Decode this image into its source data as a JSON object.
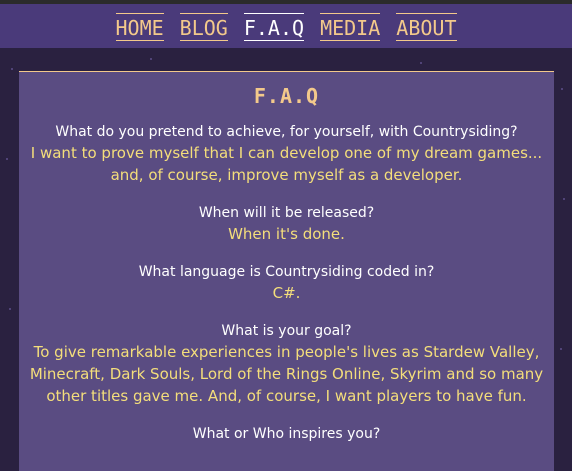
{
  "nav": {
    "items": [
      {
        "label": "HOME",
        "active": false
      },
      {
        "label": "BLOG",
        "active": false
      },
      {
        "label": "F.A.Q",
        "active": true
      },
      {
        "label": "MEDIA",
        "active": false
      },
      {
        "label": "ABOUT",
        "active": false
      }
    ]
  },
  "faq": {
    "title": "F.A.Q",
    "items": [
      {
        "question": "What do you pretend to achieve, for yourself, with Countrysiding?",
        "answer": "I want to prove myself that I can develop one of my dream games... and, of course, improve myself as a developer."
      },
      {
        "question": "When will it be released?",
        "answer": "When it's done."
      },
      {
        "question": "What language is Countrysiding coded in?",
        "answer": "C#."
      },
      {
        "question": "What is your goal?",
        "answer": "To give remarkable experiences in people's lives as Stardew Valley, Minecraft, Dark Souls, Lord of the Rings Online, Skyrim and so many other titles gave me. And, of course, I want players to have fun."
      },
      {
        "question": "What or Who inspires you?",
        "answer": ""
      }
    ]
  },
  "colors": {
    "background": "#2a2140",
    "topbar": "#4a3a7a",
    "panel": "#5a4c82",
    "accent": "#f3c98b",
    "answer": "#f4de7b",
    "question": "#ffffff"
  }
}
